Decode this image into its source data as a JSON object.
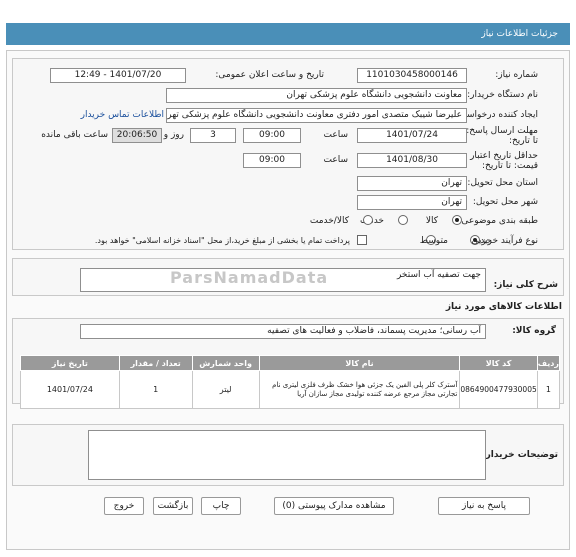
{
  "header": {
    "title": "جزئیات اطلاعات نیاز"
  },
  "watermark": "ParsNamadData",
  "fields": {
    "need_number_label": "شماره نیاز:",
    "need_number": "1101030458000146",
    "announce_label": "تاریخ و ساعت اعلان عمومی:",
    "announce_value": "1401/07/20 - 12:49",
    "buyer_org_label": "نام دستگاه خریدار:",
    "buyer_org": "معاونت دانشجویی دانشگاه علوم پزشکی تهران",
    "creator_label": "ایجاد کننده درخواست:",
    "creator": "علیرضا شیبک متصدی امور دفتری معاونت دانشجویی دانشگاه علوم پزشکی تهران",
    "contact_link": "اطلاعات تماس خریدار",
    "reply_deadline_label": "مهلت ارسال پاسخ: تا تاریخ:",
    "reply_date": "1401/07/24",
    "time_label": "ساعت",
    "reply_time": "09:00",
    "days_value": "3",
    "days_label": "روز و",
    "remaining_time": "20:06:50",
    "remaining_label": "ساعت باقی مانده",
    "min_validity_label": "حداقل تاریخ اعتبار قیمت: تا تاریخ:",
    "validity_date": "1401/08/30",
    "validity_time": "09:00",
    "province_label": "استان محل تحویل:",
    "province": "تهران",
    "city_label": "شهر محل تحویل:",
    "city": "تهران",
    "category_label": "طبقه بندی موضوعی:",
    "category_options": [
      "کالا",
      "خدمت",
      "کالا/خدمت"
    ],
    "process_label": "نوع فرآیند خرید :",
    "process_options": [
      "جزیی",
      "متوسط"
    ],
    "payment_note": "پرداخت تمام یا بخشی از مبلغ خرید،از محل \"اسناد خزانه اسلامی\" خواهد بود."
  },
  "summary": {
    "label": "شرح کلی نیاز:",
    "value": "جهت تصفیه آب استخر"
  },
  "goods": {
    "section_title": "اطلاعات کالاهای مورد نیاز",
    "group_label": "گروه کالا:",
    "group_value": "آب رسانی؛ مدیریت پسماند، فاضلاب و فعالیت های تصفیه",
    "columns": [
      "ردیف",
      "کد کالا",
      "نام کالا",
      "واحد شمارش",
      "تعداد / مقدار",
      "تاریخ نیاز"
    ],
    "rows": [
      {
        "index": "1",
        "code": "0864900477930005",
        "name": "آسترک کلر پلی الفین یک جزئی هوا خشک ظرف فلزی لیتری نام تجارتی مجاز مرجع عرضه کننده تولیدی مجاز سازان آریا",
        "unit": "لیتر",
        "qty": "1",
        "date": "1401/07/24"
      }
    ]
  },
  "buyer_notes": {
    "label": "توضیحات خریدار:",
    "value": ""
  },
  "buttons": {
    "reply": "پاسخ به نیاز",
    "docs": "مشاهده مدارک پیوستی (0)",
    "print": "چاپ",
    "back": "بازگشت",
    "exit": "خروج"
  }
}
